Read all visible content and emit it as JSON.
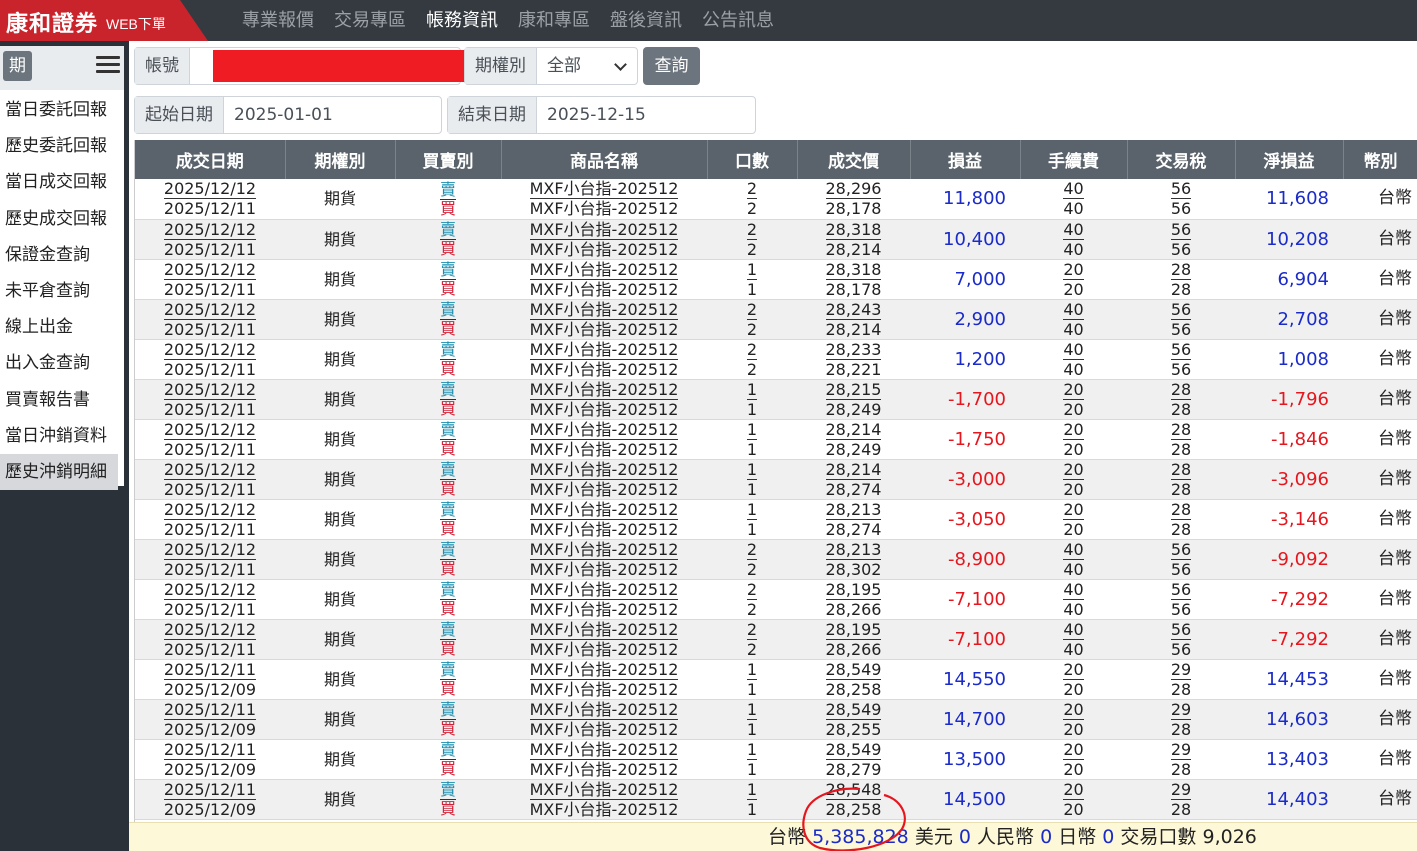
{
  "brand": {
    "name": "康和證券",
    "sub": "WEB下單"
  },
  "nav": [
    {
      "label": "專業報價",
      "active": false
    },
    {
      "label": "交易專區",
      "active": false
    },
    {
      "label": "帳務資訊",
      "active": true
    },
    {
      "label": "康和專區",
      "active": false
    },
    {
      "label": "盤後資訊",
      "active": false
    },
    {
      "label": "公告訊息",
      "active": false
    }
  ],
  "sidebar": {
    "tag": "期",
    "items": [
      {
        "label": "當日委託回報"
      },
      {
        "label": "歷史委託回報"
      },
      {
        "label": "當日成交回報"
      },
      {
        "label": "歷史成交回報"
      },
      {
        "label": "保證金查詢"
      },
      {
        "label": "未平倉查詢"
      },
      {
        "label": "線上出金"
      },
      {
        "label": "出入金查詢"
      },
      {
        "label": "買賣報告書"
      },
      {
        "label": "當日沖銷資料"
      },
      {
        "label": "歷史沖銷明細"
      }
    ],
    "active_index": 10
  },
  "filters": {
    "account_label": "帳號",
    "type_label": "期權別",
    "type_value": "全部",
    "query_button": "查詢",
    "start_label": "起始日期",
    "start_value": "2025-01-01",
    "end_label": "結束日期",
    "end_value": "2025-12-15"
  },
  "table": {
    "headers": [
      "成交日期",
      "期權別",
      "買賣別",
      "商品名稱",
      "口數",
      "成交價",
      "損益",
      "手續費",
      "交易稅",
      "淨損益",
      "幣別"
    ],
    "sell_label": "賣",
    "buy_label": "買",
    "rows": [
      {
        "d1": "2025/12/12",
        "d2": "2025/12/11",
        "type": "期貨",
        "p1": "MXF小台指-202512",
        "p2": "MXF小台指-202512",
        "q1": "2",
        "q2": "2",
        "pr1": "28,296",
        "pr2": "28,178",
        "pl": "11,800",
        "f1": "40",
        "f2": "40",
        "t1": "56",
        "t2": "56",
        "net": "11,608",
        "cur": "台幣"
      },
      {
        "d1": "2025/12/12",
        "d2": "2025/12/11",
        "type": "期貨",
        "p1": "MXF小台指-202512",
        "p2": "MXF小台指-202512",
        "q1": "2",
        "q2": "2",
        "pr1": "28,318",
        "pr2": "28,214",
        "pl": "10,400",
        "f1": "40",
        "f2": "40",
        "t1": "56",
        "t2": "56",
        "net": "10,208",
        "cur": "台幣"
      },
      {
        "d1": "2025/12/12",
        "d2": "2025/12/11",
        "type": "期貨",
        "p1": "MXF小台指-202512",
        "p2": "MXF小台指-202512",
        "q1": "1",
        "q2": "1",
        "pr1": "28,318",
        "pr2": "28,178",
        "pl": "7,000",
        "f1": "20",
        "f2": "20",
        "t1": "28",
        "t2": "28",
        "net": "6,904",
        "cur": "台幣"
      },
      {
        "d1": "2025/12/12",
        "d2": "2025/12/11",
        "type": "期貨",
        "p1": "MXF小台指-202512",
        "p2": "MXF小台指-202512",
        "q1": "2",
        "q2": "2",
        "pr1": "28,243",
        "pr2": "28,214",
        "pl": "2,900",
        "f1": "40",
        "f2": "40",
        "t1": "56",
        "t2": "56",
        "net": "2,708",
        "cur": "台幣"
      },
      {
        "d1": "2025/12/12",
        "d2": "2025/12/11",
        "type": "期貨",
        "p1": "MXF小台指-202512",
        "p2": "MXF小台指-202512",
        "q1": "2",
        "q2": "2",
        "pr1": "28,233",
        "pr2": "28,221",
        "pl": "1,200",
        "f1": "40",
        "f2": "40",
        "t1": "56",
        "t2": "56",
        "net": "1,008",
        "cur": "台幣"
      },
      {
        "d1": "2025/12/12",
        "d2": "2025/12/11",
        "type": "期貨",
        "p1": "MXF小台指-202512",
        "p2": "MXF小台指-202512",
        "q1": "1",
        "q2": "1",
        "pr1": "28,215",
        "pr2": "28,249",
        "pl": "-1,700",
        "f1": "20",
        "f2": "20",
        "t1": "28",
        "t2": "28",
        "net": "-1,796",
        "cur": "台幣"
      },
      {
        "d1": "2025/12/12",
        "d2": "2025/12/11",
        "type": "期貨",
        "p1": "MXF小台指-202512",
        "p2": "MXF小台指-202512",
        "q1": "1",
        "q2": "1",
        "pr1": "28,214",
        "pr2": "28,249",
        "pl": "-1,750",
        "f1": "20",
        "f2": "20",
        "t1": "28",
        "t2": "28",
        "net": "-1,846",
        "cur": "台幣"
      },
      {
        "d1": "2025/12/12",
        "d2": "2025/12/11",
        "type": "期貨",
        "p1": "MXF小台指-202512",
        "p2": "MXF小台指-202512",
        "q1": "1",
        "q2": "1",
        "pr1": "28,214",
        "pr2": "28,274",
        "pl": "-3,000",
        "f1": "20",
        "f2": "20",
        "t1": "28",
        "t2": "28",
        "net": "-3,096",
        "cur": "台幣"
      },
      {
        "d1": "2025/12/12",
        "d2": "2025/12/11",
        "type": "期貨",
        "p1": "MXF小台指-202512",
        "p2": "MXF小台指-202512",
        "q1": "1",
        "q2": "1",
        "pr1": "28,213",
        "pr2": "28,274",
        "pl": "-3,050",
        "f1": "20",
        "f2": "20",
        "t1": "28",
        "t2": "28",
        "net": "-3,146",
        "cur": "台幣"
      },
      {
        "d1": "2025/12/12",
        "d2": "2025/12/11",
        "type": "期貨",
        "p1": "MXF小台指-202512",
        "p2": "MXF小台指-202512",
        "q1": "2",
        "q2": "2",
        "pr1": "28,213",
        "pr2": "28,302",
        "pl": "-8,900",
        "f1": "40",
        "f2": "40",
        "t1": "56",
        "t2": "56",
        "net": "-9,092",
        "cur": "台幣"
      },
      {
        "d1": "2025/12/12",
        "d2": "2025/12/11",
        "type": "期貨",
        "p1": "MXF小台指-202512",
        "p2": "MXF小台指-202512",
        "q1": "2",
        "q2": "2",
        "pr1": "28,195",
        "pr2": "28,266",
        "pl": "-7,100",
        "f1": "40",
        "f2": "40",
        "t1": "56",
        "t2": "56",
        "net": "-7,292",
        "cur": "台幣"
      },
      {
        "d1": "2025/12/12",
        "d2": "2025/12/11",
        "type": "期貨",
        "p1": "MXF小台指-202512",
        "p2": "MXF小台指-202512",
        "q1": "2",
        "q2": "2",
        "pr1": "28,195",
        "pr2": "28,266",
        "pl": "-7,100",
        "f1": "40",
        "f2": "40",
        "t1": "56",
        "t2": "56",
        "net": "-7,292",
        "cur": "台幣"
      },
      {
        "d1": "2025/12/11",
        "d2": "2025/12/09",
        "type": "期貨",
        "p1": "MXF小台指-202512",
        "p2": "MXF小台指-202512",
        "q1": "1",
        "q2": "1",
        "pr1": "28,549",
        "pr2": "28,258",
        "pl": "14,550",
        "f1": "20",
        "f2": "20",
        "t1": "29",
        "t2": "28",
        "net": "14,453",
        "cur": "台幣"
      },
      {
        "d1": "2025/12/11",
        "d2": "2025/12/09",
        "type": "期貨",
        "p1": "MXF小台指-202512",
        "p2": "MXF小台指-202512",
        "q1": "1",
        "q2": "1",
        "pr1": "28,549",
        "pr2": "28,255",
        "pl": "14,700",
        "f1": "20",
        "f2": "20",
        "t1": "29",
        "t2": "28",
        "net": "14,603",
        "cur": "台幣"
      },
      {
        "d1": "2025/12/11",
        "d2": "2025/12/09",
        "type": "期貨",
        "p1": "MXF小台指-202512",
        "p2": "MXF小台指-202512",
        "q1": "1",
        "q2": "1",
        "pr1": "28,549",
        "pr2": "28,279",
        "pl": "13,500",
        "f1": "20",
        "f2": "20",
        "t1": "29",
        "t2": "28",
        "net": "13,403",
        "cur": "台幣"
      },
      {
        "d1": "2025/12/11",
        "d2": "2025/12/09",
        "type": "期貨",
        "p1": "MXF小台指-202512",
        "p2": "MXF小台指-202512",
        "q1": "1",
        "q2": "1",
        "pr1": "28,548",
        "pr2": "28,258",
        "pl": "14,500",
        "f1": "20",
        "f2": "20",
        "t1": "29",
        "t2": "28",
        "net": "14,403",
        "cur": "台幣"
      }
    ]
  },
  "footer": {
    "twd_label": "台幣",
    "twd_value": "5,385,828",
    "usd_label": "美元",
    "usd_value": "0",
    "rmb_label": "人民幣",
    "rmb_value": "0",
    "jpy_label": "日幣",
    "jpy_value": "0",
    "lots_label": "交易口數",
    "lots_value": "9,026"
  },
  "colors": {
    "brand_red": "#c9242b",
    "positive": "#1a2bc9",
    "negative": "#e5161e",
    "sell": "#1a8fb0",
    "buy": "#d0243a",
    "annotation": "#e5161e"
  }
}
